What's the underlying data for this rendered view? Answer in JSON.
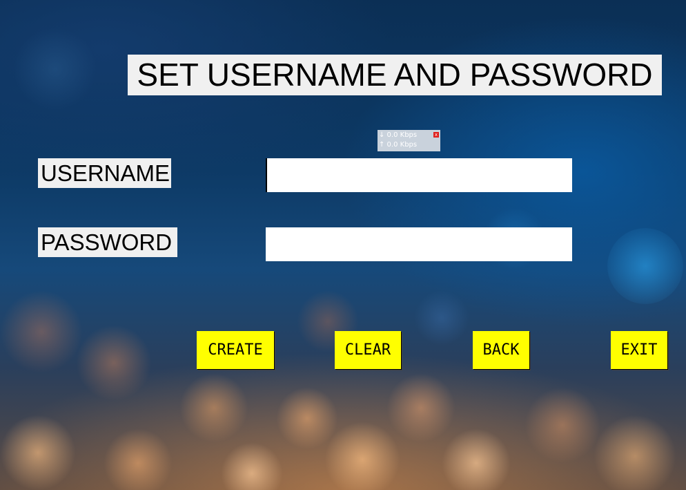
{
  "window": {
    "title": "SET USERNAME AND PASSWORD"
  },
  "network_meter": {
    "download": "↓ 0.0 Kbps",
    "upload": "↑ 0.0 Kbps",
    "close_glyph": "x"
  },
  "form": {
    "username_label": "USERNAME",
    "password_label": "PASSWORD",
    "username_value": "",
    "password_value": ""
  },
  "buttons": {
    "create": "CREATE",
    "clear": "CLEAR",
    "back": "BACK",
    "exit": "EXIT"
  },
  "colors": {
    "button_bg": "#ffff00",
    "label_bg": "#f0f0f0",
    "background_blue": "#0b2f55",
    "bokeh_orange": "#e89a5a"
  }
}
